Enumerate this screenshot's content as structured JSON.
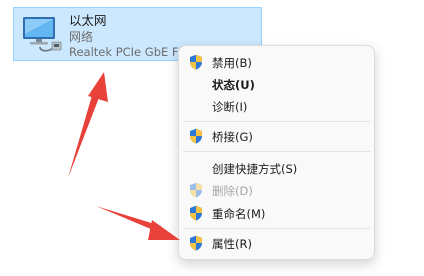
{
  "adapter": {
    "name": "以太网",
    "type": "网络",
    "device": "Realtek PCIe GbE Family Controller",
    "icon": "network-adapter-icon"
  },
  "context_menu": {
    "items": [
      {
        "label": "禁用(B)",
        "icon": "uac-shield-icon",
        "bold": false,
        "disabled": false
      },
      {
        "label": "状态(U)",
        "icon": "",
        "bold": true,
        "disabled": false
      },
      {
        "label": "诊断(I)",
        "icon": "",
        "bold": false,
        "disabled": false
      },
      {
        "label": "桥接(G)",
        "icon": "uac-shield-icon",
        "bold": false,
        "disabled": false
      },
      {
        "label": "创建快捷方式(S)",
        "icon": "",
        "bold": false,
        "disabled": false
      },
      {
        "label": "删除(D)",
        "icon": "uac-shield-icon",
        "bold": false,
        "disabled": true
      },
      {
        "label": "重命名(M)",
        "icon": "uac-shield-icon",
        "bold": false,
        "disabled": false
      },
      {
        "label": "属性(R)",
        "icon": "uac-shield-icon",
        "bold": false,
        "disabled": false
      }
    ]
  },
  "colors": {
    "selection_bg": "#cce8ff",
    "annotation_arrow": "#e8413a",
    "shield_blue": "#2b78d6",
    "shield_yellow": "#f6c244"
  }
}
